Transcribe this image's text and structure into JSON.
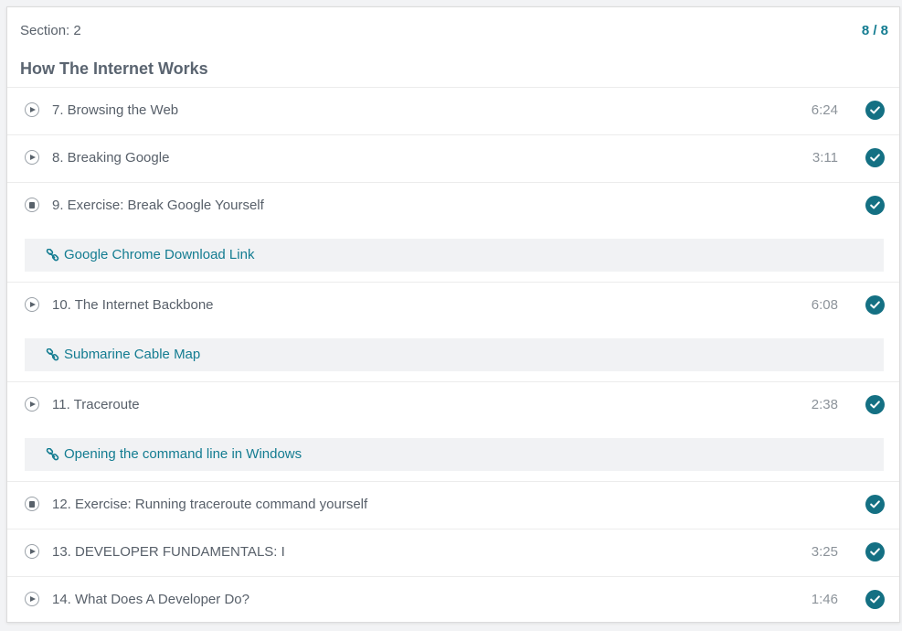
{
  "section": {
    "label": "Section: 2",
    "progress": "8 / 8",
    "title": "How The Internet Works"
  },
  "colors": {
    "accent": "#137c91",
    "check_bg": "#147083",
    "resource_bg": "#f1f2f4"
  },
  "lectures": [
    {
      "title": "7. Browsing the Web",
      "type": "video",
      "duration": "6:24",
      "completed": true,
      "resource": null
    },
    {
      "title": "8. Breaking Google",
      "type": "video",
      "duration": "3:11",
      "completed": true,
      "resource": null
    },
    {
      "title": "9. Exercise: Break Google Yourself",
      "type": "article",
      "duration": "",
      "completed": true,
      "resource": "Google Chrome Download Link"
    },
    {
      "title": "10. The Internet Backbone",
      "type": "video",
      "duration": "6:08",
      "completed": true,
      "resource": "Submarine Cable Map"
    },
    {
      "title": "11. Traceroute",
      "type": "video",
      "duration": "2:38",
      "completed": true,
      "resource": "Opening the command line in Windows"
    },
    {
      "title": "12. Exercise: Running traceroute command yourself",
      "type": "article",
      "duration": "",
      "completed": true,
      "resource": null
    },
    {
      "title": "13. DEVELOPER FUNDAMENTALS: I",
      "type": "video",
      "duration": "3:25",
      "completed": true,
      "resource": null
    },
    {
      "title": "14. What Does A Developer Do?",
      "type": "video",
      "duration": "1:46",
      "completed": true,
      "resource": null
    }
  ]
}
